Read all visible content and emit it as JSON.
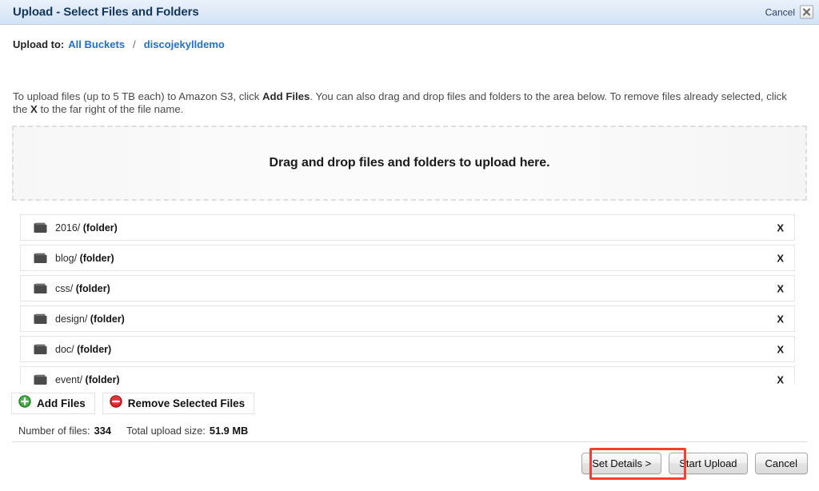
{
  "window": {
    "title": "Upload - Select Files and Folders",
    "cancel_label": "Cancel",
    "close_icon": "close-x-icon"
  },
  "breadcrumb": {
    "label": "Upload to:",
    "separator": "/",
    "items": [
      {
        "text": "All Buckets"
      },
      {
        "text": "discojekylldemo"
      }
    ]
  },
  "instructions": {
    "part1": "To upload files (up to 5 TB each) to Amazon S3, click ",
    "bold1": "Add Files",
    "part2": ". You can also drag and drop files and folders to the area below. To remove files already selected, click the ",
    "bold2": "X",
    "part3": " to the far right of the file name."
  },
  "dropzone": {
    "text": "Drag and drop files and folders to upload here."
  },
  "file_list": {
    "remove_row_label": "X",
    "rows": [
      {
        "name": "2016/",
        "type": "(folder)",
        "icon": "folder-icon"
      },
      {
        "name": "blog/",
        "type": "(folder)",
        "icon": "folder-icon"
      },
      {
        "name": "css/",
        "type": "(folder)",
        "icon": "folder-icon"
      },
      {
        "name": "design/",
        "type": "(folder)",
        "icon": "folder-icon"
      },
      {
        "name": "doc/",
        "type": "(folder)",
        "icon": "folder-icon"
      },
      {
        "name": "event/",
        "type": "(folder)",
        "icon": "folder-icon"
      }
    ]
  },
  "actions": {
    "add_files": {
      "label": "Add Files",
      "icon": "plus-circle-green-icon",
      "color": "#2ca02c"
    },
    "remove_selected": {
      "label": "Remove Selected Files",
      "icon": "minus-circle-red-icon",
      "color": "#d81f1f"
    }
  },
  "stats": {
    "count_label": "Number of files:",
    "count_value": "334",
    "size_label": "Total upload size:",
    "size_value": "51.9 MB"
  },
  "footer": {
    "set_details": "Set Details >",
    "start_upload": "Start Upload",
    "cancel": "Cancel"
  },
  "annotation": {
    "color": "#f4402e",
    "target": "set-details-button"
  }
}
